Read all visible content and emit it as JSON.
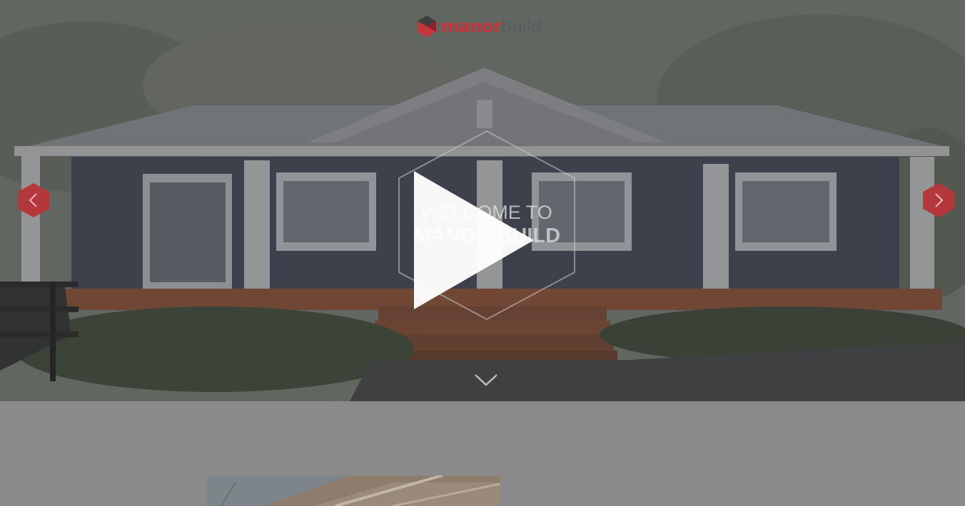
{
  "brand": {
    "logo_part1": "manor",
    "logo_part2": "build",
    "accent_color": "#c7343a"
  },
  "hero": {
    "welcome_line1": "WELCOME TO",
    "welcome_line2": "MANOR BUILD",
    "play_icon": "play-icon",
    "prev_icon": "chevron-left-icon",
    "next_icon": "chevron-right-icon",
    "scroll_icon": "chevron-down-icon"
  }
}
